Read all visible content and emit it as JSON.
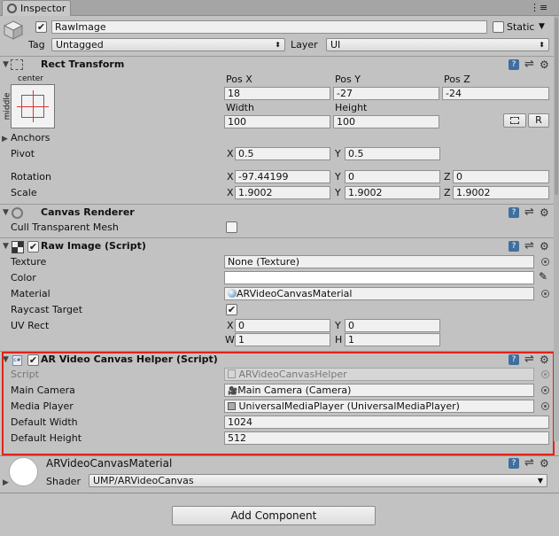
{
  "tab": {
    "title": "Inspector"
  },
  "object": {
    "active": "✔",
    "name": "RawImage",
    "static_label": "Static",
    "tag_label": "Tag",
    "tag_value": "Untagged",
    "layer_label": "Layer",
    "layer_value": "UI"
  },
  "rect": {
    "title": "Rect Transform",
    "anchor_h": "center",
    "anchor_v": "middle",
    "posx_label": "Pos X",
    "posy_label": "Pos Y",
    "posz_label": "Pos Z",
    "posx": "18",
    "posy": "-27",
    "posz": "-24",
    "width_label": "Width",
    "height_label": "Height",
    "width": "100",
    "height": "100",
    "r_label": "R",
    "anchors_label": "Anchors",
    "pivot_label": "Pivot",
    "pivot_x": "0.5",
    "pivot_y": "0.5",
    "rotation_label": "Rotation",
    "rot_x": "-97.44199",
    "rot_y": "0",
    "rot_z": "0",
    "scale_label": "Scale",
    "scale_x": "1.9002",
    "scale_y": "1.9002",
    "scale_z": "1.9002",
    "x": "X",
    "y": "Y",
    "z": "Z"
  },
  "canvas_renderer": {
    "title": "Canvas Renderer",
    "cull_label": "Cull Transparent Mesh"
  },
  "raw_image": {
    "title": "Raw Image (Script)",
    "texture_label": "Texture",
    "texture_value": "None (Texture)",
    "color_label": "Color",
    "material_label": "Material",
    "material_value": "ARVideoCanvasMaterial",
    "raycast_label": "Raycast Target",
    "raycast_check": "✔",
    "uvrect_label": "UV Rect",
    "uv_x": "0",
    "uv_y": "0",
    "uv_w": "1",
    "uv_h": "1",
    "x": "X",
    "y": "Y",
    "w": "W",
    "h": "H"
  },
  "helper": {
    "title": "AR Video Canvas Helper (Script)",
    "check": "✔",
    "script_label": "Script",
    "script_value": "ARVideoCanvasHelper",
    "camera_label": "Main Camera",
    "camera_value": "Main Camera (Camera)",
    "player_label": "Media Player",
    "player_value": "UniversalMediaPlayer (UniversalMediaPlayer)",
    "dwidth_label": "Default Width",
    "dwidth_value": "1024",
    "dheight_label": "Default Height",
    "dheight_value": "512"
  },
  "material": {
    "name": "ARVideoCanvasMaterial",
    "shader_label": "Shader",
    "shader_value": "UMP/ARVideoCanvas"
  },
  "add_component": {
    "label": "Add Component"
  },
  "colors": {
    "highlight": "#e2231a",
    "panel": "#c2c2c2"
  }
}
